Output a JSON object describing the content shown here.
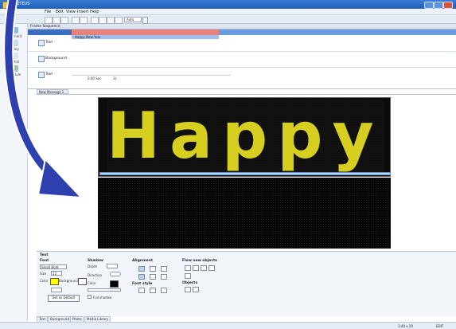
{
  "window": {
    "title": "PROTEUS"
  },
  "menu": [
    "File",
    "Edit",
    "View",
    "Insert",
    "Help"
  ],
  "toolbar": {
    "zoom": "Auto"
  },
  "sidebar": {
    "items": [
      "Document",
      "Library",
      "Playlist",
      "Schedule"
    ]
  },
  "sequence": {
    "title": "Frame Sequence",
    "track_cell": "Happy New Year",
    "rows": [
      "Text",
      "Background",
      "Text"
    ],
    "footer_time": "0.00 Sec",
    "footer_frames": "1s"
  },
  "editor": {
    "tab_label": "New Message 1",
    "display_text": "Happy"
  },
  "text_panel": {
    "title": "Text",
    "font": {
      "heading": "Font",
      "face": "Small Bold",
      "size_label": "Size",
      "size": "12",
      "color_label": "Color",
      "background_label": "Background",
      "default_button": "Set as Default"
    },
    "shadow": {
      "heading": "Shadow",
      "depth_label": "Depth",
      "direction_label": "Direction",
      "color_label": "Color",
      "full_shadow": "Full shadow"
    },
    "alignment": {
      "heading": "Alignment",
      "font_style": "Font style"
    },
    "flow": {
      "heading": "Flow new objects",
      "objects": "Objects"
    }
  },
  "bottom_tabs": [
    "Text",
    "Background",
    "Photo",
    "Media Library"
  ],
  "status": {
    "position": "1:40 x 20",
    "mode": "EDIT"
  },
  "colors": {
    "titlebar": "#1f5fb8",
    "led_text": "#d6cf1f",
    "led_bg": "#0c0c0c",
    "arrow": "#2e3fb0",
    "arrow_outline": "#ffffff"
  }
}
